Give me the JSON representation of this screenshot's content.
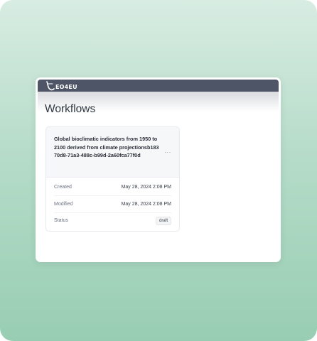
{
  "app": {
    "logo_text": "EO4EU"
  },
  "page": {
    "title": "Workflows"
  },
  "workflow_card": {
    "title": "Global bioclimatic indicators from 1950 to 2100 derived from climate projectionsb18370d8-71a3-488c-b99d-2a60fca77f0d",
    "more_label": "···",
    "fields": [
      {
        "label": "Created",
        "value": "May 28, 2024 2:08 PM"
      },
      {
        "label": "Modified",
        "value": "May 28, 2024 2:08 PM"
      },
      {
        "label": "Status",
        "value": "draft"
      }
    ]
  },
  "colors": {
    "topbar": "#4d5566",
    "background_gradient_top": "#d8ece2",
    "background_gradient_bottom": "#98cdb3"
  }
}
